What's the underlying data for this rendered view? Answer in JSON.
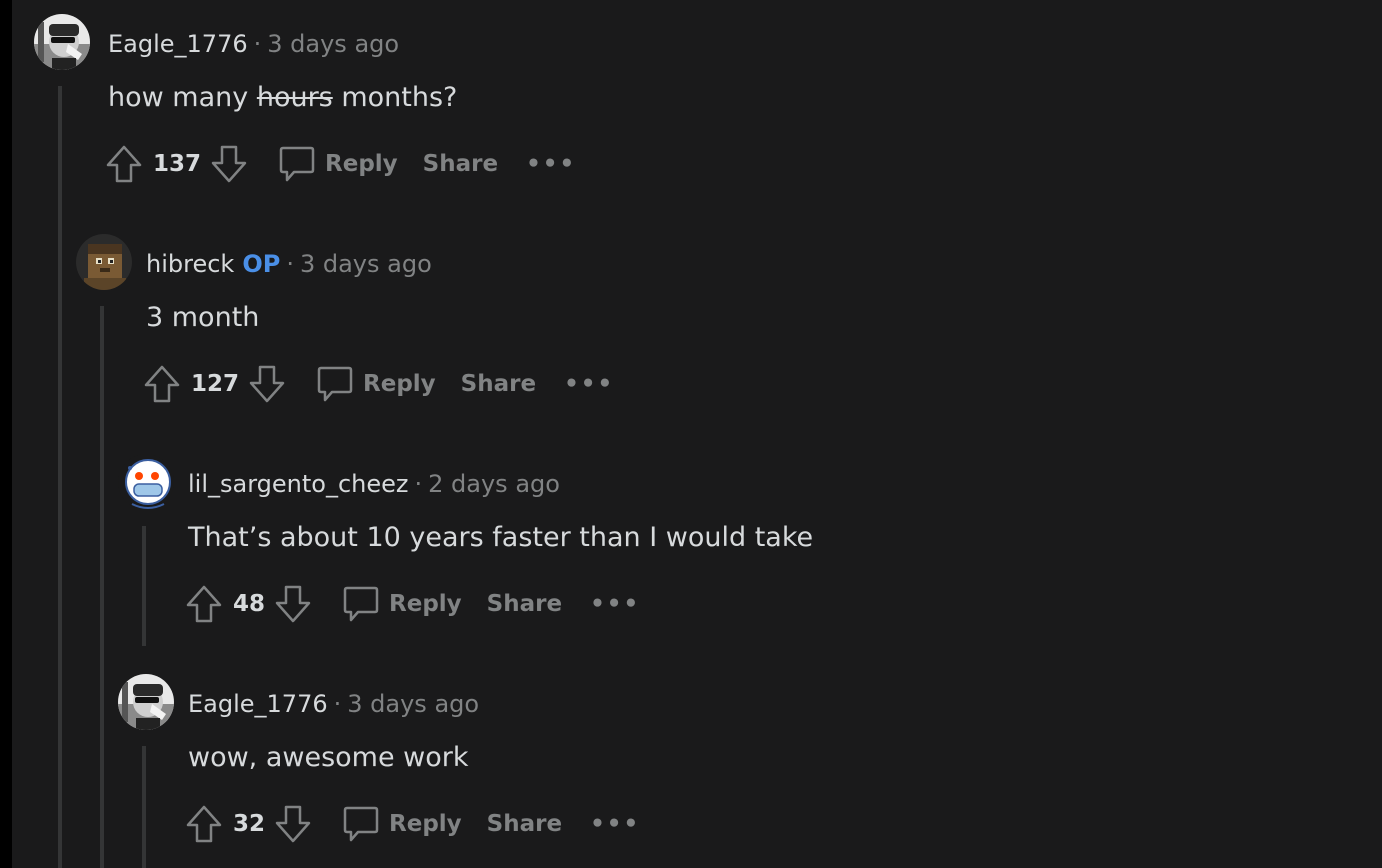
{
  "comments": [
    {
      "username": "Eagle_1776",
      "badge": "",
      "time": "3 days ago",
      "body_pre": "how many ",
      "body_struck": "hours",
      "body_post": " months?",
      "score": "137",
      "reply_label": "Reply",
      "share_label": "Share",
      "avatar": "eagle-avatar"
    },
    {
      "username": "hibreck",
      "badge": "OP",
      "time": "3 days ago",
      "body": "3 month",
      "score": "127",
      "reply_label": "Reply",
      "share_label": "Share",
      "avatar": "pixel-head-avatar"
    },
    {
      "username": "lil_sargento_cheez",
      "badge": "",
      "time": "2 days ago",
      "body": "That’s about 10 years faster than I would take",
      "score": "48",
      "reply_label": "Reply",
      "share_label": "Share",
      "avatar": "snoo-avatar"
    },
    {
      "username": "Eagle_1776",
      "badge": "",
      "time": "3 days ago",
      "body": "wow, awesome work",
      "score": "32",
      "reply_label": "Reply",
      "share_label": "Share",
      "avatar": "eagle-avatar"
    }
  ],
  "separator": "·",
  "more_label": "•••",
  "colors": {
    "background": "#1a1a1b",
    "text": "#d7dadc",
    "muted": "#818384",
    "op_badge": "#4a8fe7",
    "thread_line": "#343536"
  },
  "icons": [
    "upvote-icon",
    "downvote-icon",
    "comment-bubble-icon",
    "more-options-icon"
  ]
}
